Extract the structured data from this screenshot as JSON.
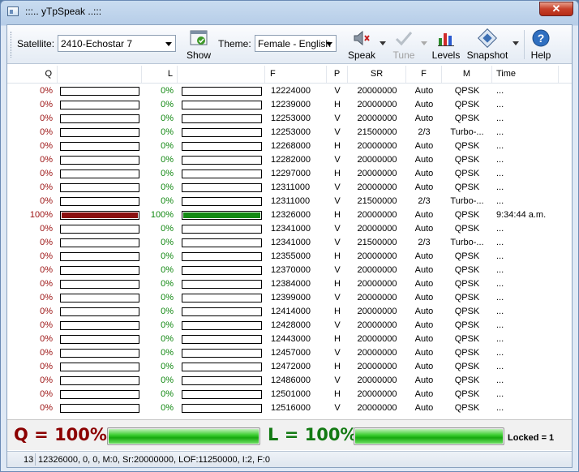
{
  "window": {
    "title": ":::.. yTpSpeak ..:::"
  },
  "toolbar": {
    "satellite_label": "Satellite:",
    "satellite_value": "2410-Echostar 7",
    "show_label": "Show",
    "theme_label": "Theme:",
    "theme_value": "Female - English",
    "speak_label": "Speak",
    "tune_label": "Tune",
    "levels_label": "Levels",
    "snapshot_label": "Snapshot",
    "help_label": "Help"
  },
  "columns": [
    "Q",
    "L",
    "F",
    "P",
    "SR",
    "F",
    "M",
    "Time"
  ],
  "rows": [
    {
      "q": "0%",
      "qv": 0,
      "l": "0%",
      "lv": 0,
      "freq": "12224000",
      "pol": "V",
      "sr": "20000000",
      "fec": "Auto",
      "mod": "QPSK",
      "time": "..."
    },
    {
      "q": "0%",
      "qv": 0,
      "l": "0%",
      "lv": 0,
      "freq": "12239000",
      "pol": "H",
      "sr": "20000000",
      "fec": "Auto",
      "mod": "QPSK",
      "time": "..."
    },
    {
      "q": "0%",
      "qv": 0,
      "l": "0%",
      "lv": 0,
      "freq": "12253000",
      "pol": "V",
      "sr": "20000000",
      "fec": "Auto",
      "mod": "QPSK",
      "time": "..."
    },
    {
      "q": "0%",
      "qv": 0,
      "l": "0%",
      "lv": 0,
      "freq": "12253000",
      "pol": "V",
      "sr": "21500000",
      "fec": "2/3",
      "mod": "Turbo-...",
      "time": "..."
    },
    {
      "q": "0%",
      "qv": 0,
      "l": "0%",
      "lv": 0,
      "freq": "12268000",
      "pol": "H",
      "sr": "20000000",
      "fec": "Auto",
      "mod": "QPSK",
      "time": "..."
    },
    {
      "q": "0%",
      "qv": 0,
      "l": "0%",
      "lv": 0,
      "freq": "12282000",
      "pol": "V",
      "sr": "20000000",
      "fec": "Auto",
      "mod": "QPSK",
      "time": "..."
    },
    {
      "q": "0%",
      "qv": 0,
      "l": "0%",
      "lv": 0,
      "freq": "12297000",
      "pol": "H",
      "sr": "20000000",
      "fec": "Auto",
      "mod": "QPSK",
      "time": "..."
    },
    {
      "q": "0%",
      "qv": 0,
      "l": "0%",
      "lv": 0,
      "freq": "12311000",
      "pol": "V",
      "sr": "20000000",
      "fec": "Auto",
      "mod": "QPSK",
      "time": "..."
    },
    {
      "q": "0%",
      "qv": 0,
      "l": "0%",
      "lv": 0,
      "freq": "12311000",
      "pol": "V",
      "sr": "21500000",
      "fec": "2/3",
      "mod": "Turbo-...",
      "time": "..."
    },
    {
      "q": "100%",
      "qv": 100,
      "l": "100%",
      "lv": 100,
      "freq": "12326000",
      "pol": "H",
      "sr": "20000000",
      "fec": "Auto",
      "mod": "QPSK",
      "time": "9:34:44 a.m."
    },
    {
      "q": "0%",
      "qv": 0,
      "l": "0%",
      "lv": 0,
      "freq": "12341000",
      "pol": "V",
      "sr": "20000000",
      "fec": "Auto",
      "mod": "QPSK",
      "time": "..."
    },
    {
      "q": "0%",
      "qv": 0,
      "l": "0%",
      "lv": 0,
      "freq": "12341000",
      "pol": "V",
      "sr": "21500000",
      "fec": "2/3",
      "mod": "Turbo-...",
      "time": "..."
    },
    {
      "q": "0%",
      "qv": 0,
      "l": "0%",
      "lv": 0,
      "freq": "12355000",
      "pol": "H",
      "sr": "20000000",
      "fec": "Auto",
      "mod": "QPSK",
      "time": "..."
    },
    {
      "q": "0%",
      "qv": 0,
      "l": "0%",
      "lv": 0,
      "freq": "12370000",
      "pol": "V",
      "sr": "20000000",
      "fec": "Auto",
      "mod": "QPSK",
      "time": "..."
    },
    {
      "q": "0%",
      "qv": 0,
      "l": "0%",
      "lv": 0,
      "freq": "12384000",
      "pol": "H",
      "sr": "20000000",
      "fec": "Auto",
      "mod": "QPSK",
      "time": "..."
    },
    {
      "q": "0%",
      "qv": 0,
      "l": "0%",
      "lv": 0,
      "freq": "12399000",
      "pol": "V",
      "sr": "20000000",
      "fec": "Auto",
      "mod": "QPSK",
      "time": "..."
    },
    {
      "q": "0%",
      "qv": 0,
      "l": "0%",
      "lv": 0,
      "freq": "12414000",
      "pol": "H",
      "sr": "20000000",
      "fec": "Auto",
      "mod": "QPSK",
      "time": "..."
    },
    {
      "q": "0%",
      "qv": 0,
      "l": "0%",
      "lv": 0,
      "freq": "12428000",
      "pol": "V",
      "sr": "20000000",
      "fec": "Auto",
      "mod": "QPSK",
      "time": "..."
    },
    {
      "q": "0%",
      "qv": 0,
      "l": "0%",
      "lv": 0,
      "freq": "12443000",
      "pol": "H",
      "sr": "20000000",
      "fec": "Auto",
      "mod": "QPSK",
      "time": "..."
    },
    {
      "q": "0%",
      "qv": 0,
      "l": "0%",
      "lv": 0,
      "freq": "12457000",
      "pol": "V",
      "sr": "20000000",
      "fec": "Auto",
      "mod": "QPSK",
      "time": "..."
    },
    {
      "q": "0%",
      "qv": 0,
      "l": "0%",
      "lv": 0,
      "freq": "12472000",
      "pol": "H",
      "sr": "20000000",
      "fec": "Auto",
      "mod": "QPSK",
      "time": "..."
    },
    {
      "q": "0%",
      "qv": 0,
      "l": "0%",
      "lv": 0,
      "freq": "12486000",
      "pol": "V",
      "sr": "20000000",
      "fec": "Auto",
      "mod": "QPSK",
      "time": "..."
    },
    {
      "q": "0%",
      "qv": 0,
      "l": "0%",
      "lv": 0,
      "freq": "12501000",
      "pol": "H",
      "sr": "20000000",
      "fec": "Auto",
      "mod": "QPSK",
      "time": "..."
    },
    {
      "q": "0%",
      "qv": 0,
      "l": "0%",
      "lv": 0,
      "freq": "12516000",
      "pol": "V",
      "sr": "20000000",
      "fec": "Auto",
      "mod": "QPSK",
      "time": "..."
    }
  ],
  "summary": {
    "q_text": "Q = 100%",
    "q_level": 100,
    "l_text": "L = 100%",
    "l_level": 100,
    "locked_text": "Locked = 1"
  },
  "status": {
    "count": "13",
    "text": "12326000, 0, 0, M:0, Sr:20000000, LOF:11250000, I:2, F:0"
  },
  "colors": {
    "quality_bar": "#8b1010",
    "level_bar": "#138a13",
    "quality_text": "#9b1010",
    "level_text": "#118811"
  }
}
